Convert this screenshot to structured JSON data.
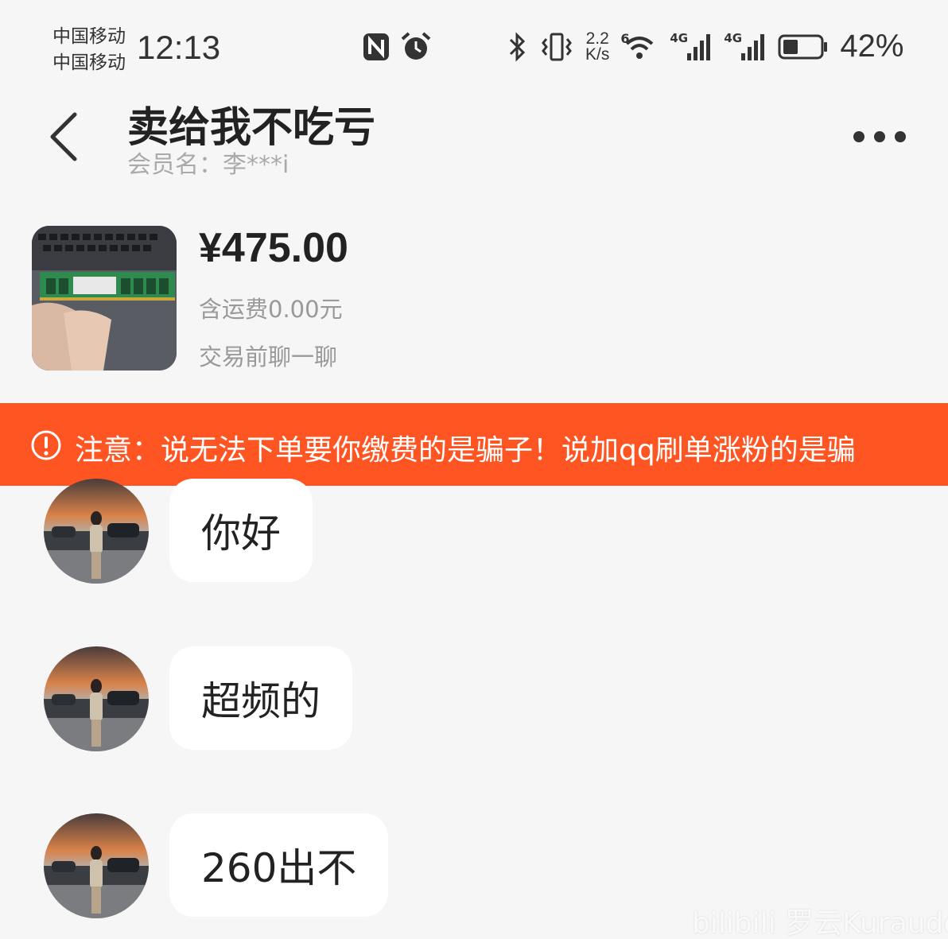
{
  "status_bar": {
    "carrier_1": "中国移动",
    "carrier_2": "中国移动",
    "time": "12:13",
    "net_speed_value": "2.2",
    "net_speed_unit": "K/s",
    "wifi_label": "6",
    "signal_1_label": "4G",
    "signal_2_label": "4G",
    "battery_percent": "42%",
    "battery_level": 0.42,
    "icons": [
      "nfc-icon",
      "alarm-icon",
      "bluetooth-icon",
      "vibrate-icon",
      "wifi-icon",
      "signal-icon",
      "battery-icon"
    ]
  },
  "header": {
    "title": "卖给我不吃亏",
    "member_name": "会员名：李***i",
    "back_icon": "back-arrow-icon",
    "more_icon": "more-dots-icon"
  },
  "product": {
    "price": "¥475.00",
    "shipping": "含运费0.00元",
    "chat_tip": "交易前聊一聊"
  },
  "warning": {
    "text": "注意：说无法下单要你缴费的是骗子！说加qq刷单涨粉的是骗",
    "color": "#ff5523"
  },
  "messages": [
    {
      "text": "你好"
    },
    {
      "text": "超频的"
    },
    {
      "text": "260出不"
    }
  ],
  "watermark": "bilibili 罗云Kuraudo"
}
